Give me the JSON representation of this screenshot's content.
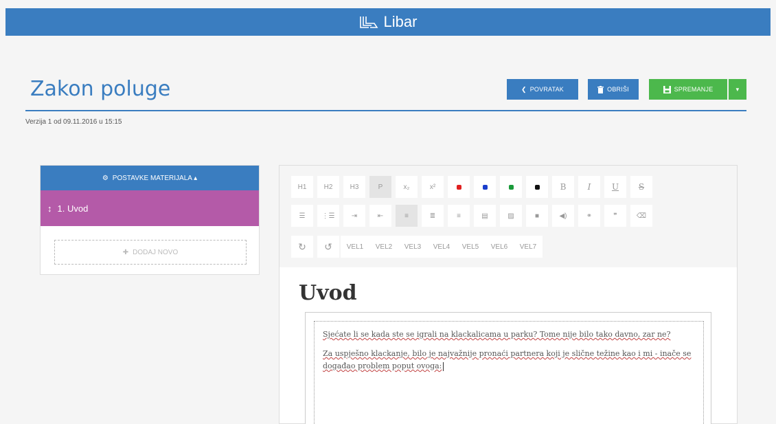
{
  "app": {
    "name": "Libar"
  },
  "page": {
    "title": "Zakon poluge",
    "version": "Verzija 1 od 09.11.2016 u 15:15"
  },
  "actions": {
    "back_label": "POVRATAK",
    "delete_label": "OBRIŠI",
    "save_label": "SPREMANJE"
  },
  "sidebar": {
    "header_label": "POSTAVKE MATERIJALA ▴",
    "items": [
      {
        "label": "1.  Uvod"
      }
    ],
    "add_label": "DODAJ NOVO"
  },
  "toolbar": {
    "row1": [
      "H1",
      "H2",
      "H3",
      "P",
      "x₂",
      "x²"
    ],
    "colors": [
      "#e02020",
      "#1a3ecc",
      "#1a9a3a",
      "#111111"
    ],
    "row1_format": [
      "B",
      "I",
      "U",
      "S"
    ],
    "row3_sizes": [
      "VEL1",
      "VEL2",
      "VEL3",
      "VEL4",
      "VEL5",
      "VEL6",
      "VEL7"
    ]
  },
  "editor": {
    "heading": "Uvod",
    "paragraphs": [
      "Sjećate li se kada ste se igrali na klackalicama u parku? Tome nije bilo tako davno, zar ne?",
      "Za uspješno klackanje, bilo je najvažnije pronaći partnera koji je slične težine kao i mi - inače se događao problem poput ovoga:"
    ]
  }
}
